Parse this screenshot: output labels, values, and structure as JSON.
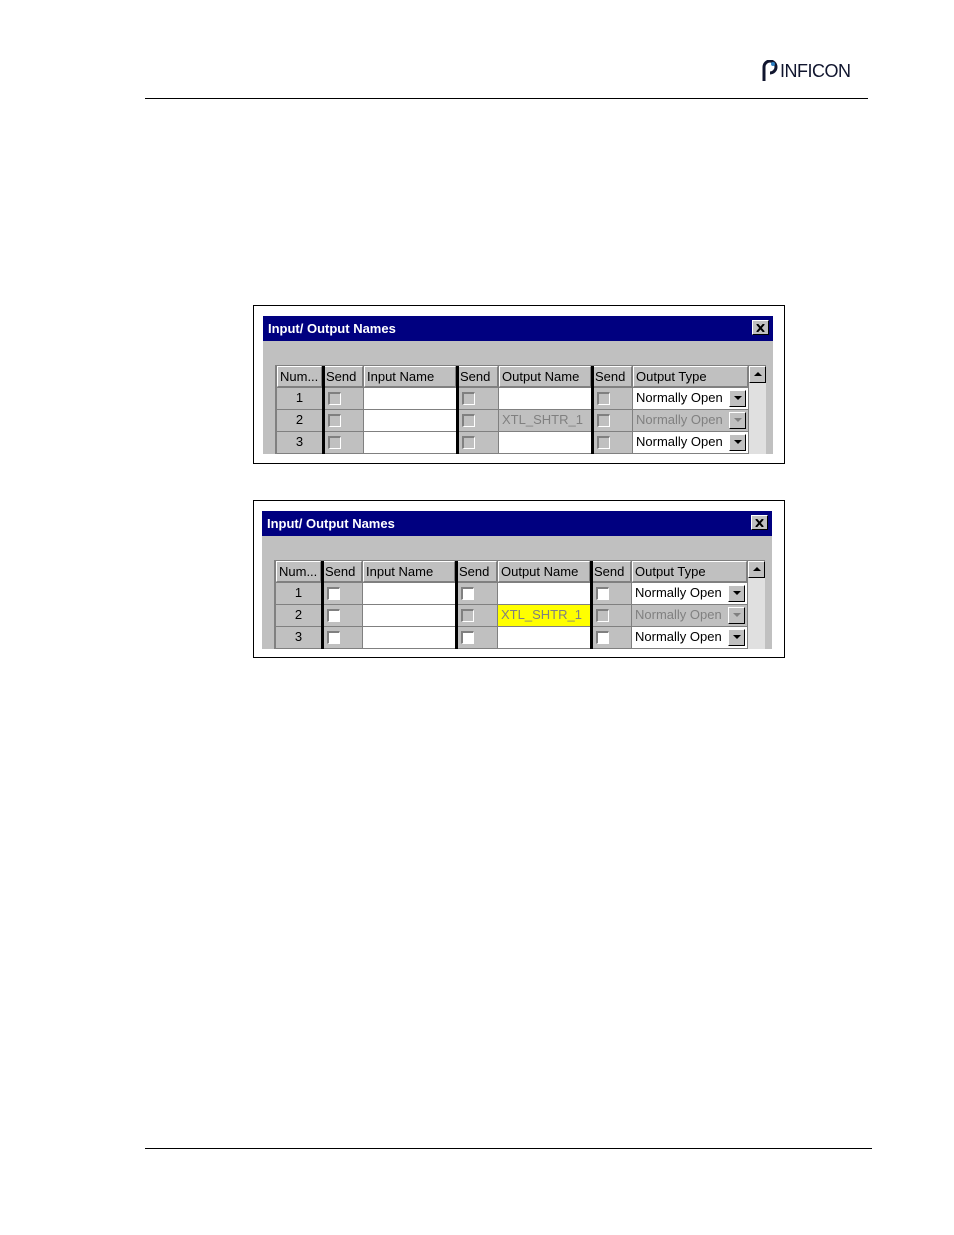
{
  "header": {
    "brand": "INFICON"
  },
  "dialogs": [
    {
      "title": "Input/ Output Names",
      "columns": [
        "Num...",
        "Send",
        "Input Name",
        "Send",
        "Output Name",
        "Send",
        "Output Type"
      ],
      "rows": [
        {
          "num": "1",
          "output_name": "",
          "output_type": "Normally Open"
        },
        {
          "num": "2",
          "output_name": "XTL_SHTR_1",
          "output_type": "Normally Open"
        },
        {
          "num": "3",
          "output_name": "",
          "output_type": "Normally Open"
        }
      ]
    },
    {
      "title": "Input/ Output Names",
      "columns": [
        "Num...",
        "Send",
        "Input Name",
        "Send",
        "Output Name",
        "Send",
        "Output Type"
      ],
      "rows": [
        {
          "num": "1",
          "output_name": "",
          "output_type": "Normally Open"
        },
        {
          "num": "2",
          "output_name": "XTL_SHTR_1",
          "output_type": "Normally Open"
        },
        {
          "num": "3",
          "output_name": "",
          "output_type": "Normally Open"
        }
      ]
    }
  ],
  "colors": {
    "titlebar": "#000080",
    "highlight": "#ffff00",
    "face": "#c0c0c0"
  }
}
